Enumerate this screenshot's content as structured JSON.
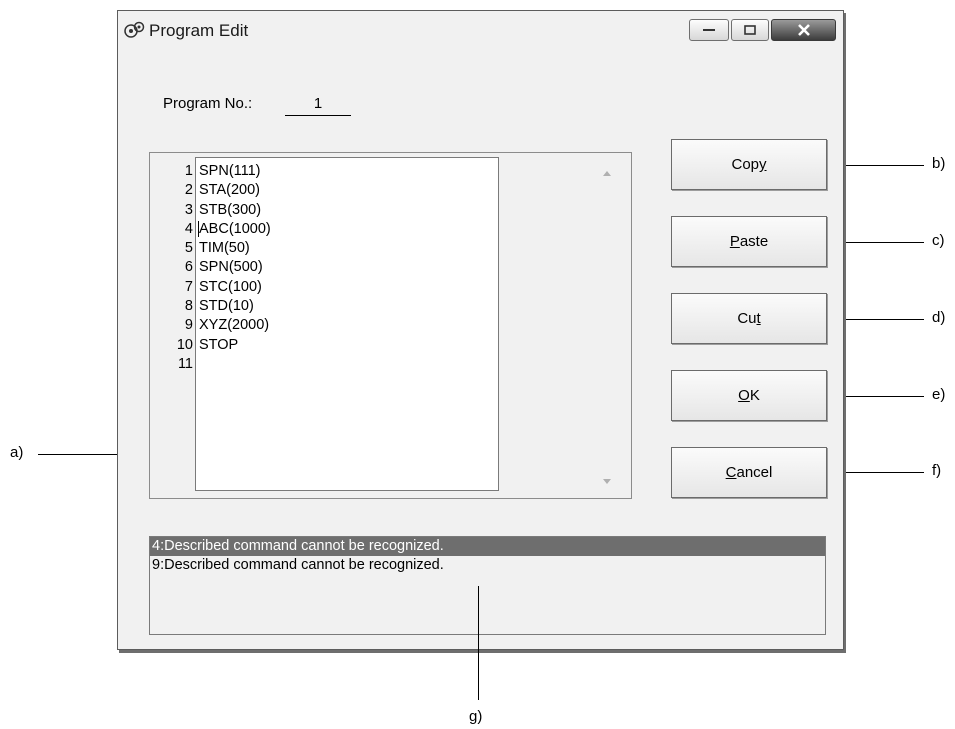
{
  "window": {
    "title": "Program Edit"
  },
  "program": {
    "label": "Program No.:",
    "value": "1"
  },
  "editor": {
    "line_numbers": [
      "1",
      "2",
      "3",
      "4",
      "5",
      "6",
      "7",
      "8",
      "9",
      "10",
      "11"
    ],
    "lines": [
      "SPN(111)",
      "STA(200)",
      "STB(300)",
      "ABC(1000)",
      "TIM(50)",
      "SPN(500)",
      "STC(100)",
      "STD(10)",
      "XYZ(2000)",
      "STOP",
      ""
    ]
  },
  "buttons": {
    "copy": {
      "pre": "Cop",
      "key": "y",
      "post": ""
    },
    "paste": {
      "pre": "",
      "key": "P",
      "post": "aste"
    },
    "cut": {
      "pre": "Cu",
      "key": "t",
      "post": ""
    },
    "ok": {
      "pre": "",
      "key": "O",
      "post": "K"
    },
    "cancel": {
      "pre": "",
      "key": "C",
      "post": "ancel"
    }
  },
  "messages": [
    "4:Described command cannot be recognized.",
    "9:Described command cannot be recognized."
  ],
  "callouts": {
    "a": "a)",
    "b": "b)",
    "c": "c)",
    "d": "d)",
    "e": "e)",
    "f": "f)",
    "g": "g)"
  },
  "colors": {
    "selected_message_bg": "#6e6e6e",
    "window_bg": "#f1f1f1"
  }
}
